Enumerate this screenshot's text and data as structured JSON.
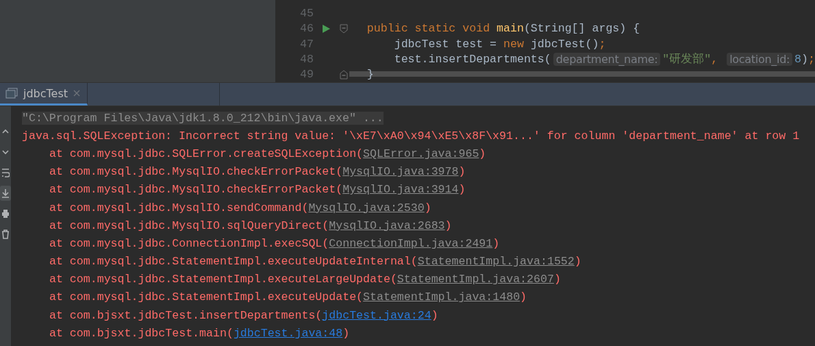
{
  "editor": {
    "lines": [
      {
        "number": "45",
        "run": false,
        "fold_start": false,
        "fold_end": false
      },
      {
        "number": "46",
        "run": true,
        "fold_start": true,
        "fold_end": false,
        "tokens": [
          {
            "kind": "keyword",
            "text": "public static void "
          },
          {
            "kind": "method",
            "text": "main"
          },
          {
            "kind": "plain",
            "text": "(String[] args) {"
          }
        ]
      },
      {
        "number": "47",
        "run": false,
        "fold_start": false,
        "fold_end": false,
        "tokens": [
          {
            "kind": "plain",
            "text": "    jdbcTest test = "
          },
          {
            "kind": "keyword",
            "text": "new "
          },
          {
            "kind": "plain",
            "text": "jdbcTest()"
          },
          {
            "kind": "keyword",
            "text": ";"
          }
        ]
      },
      {
        "number": "48",
        "run": false,
        "fold_start": false,
        "fold_end": false,
        "tokens": [
          {
            "kind": "plain",
            "text": "    test.insertDepartments("
          },
          {
            "kind": "hint",
            "text": "department_name:"
          },
          {
            "kind": "string",
            "text": "\"研发部\""
          },
          {
            "kind": "keyword",
            "text": ", "
          },
          {
            "kind": "hint",
            "text": "location_id:"
          },
          {
            "kind": "number",
            "text": "8"
          },
          {
            "kind": "plain",
            "text": ")"
          },
          {
            "kind": "keyword",
            "text": ";"
          }
        ]
      },
      {
        "number": "49",
        "run": false,
        "fold_start": false,
        "fold_end": true,
        "tokens": [
          {
            "kind": "plain",
            "text": "}"
          }
        ]
      }
    ]
  },
  "run_tabs": [
    {
      "label": "jdbcTest",
      "selected": true
    }
  ],
  "console": {
    "command": "\"C:\\Program Files\\Java\\jdk1.8.0_212\\bin\\java.exe\" ...",
    "error": "java.sql.SQLException: Incorrect string value: '\\xE7\\xA0\\x94\\xE5\\x8F\\x91...' for column 'department_name' at row 1",
    "frames": [
      {
        "text": "at com.mysql.jdbc.SQLError.createSQLException(",
        "link": "SQLError.java:965",
        "close": ")",
        "kind": "library"
      },
      {
        "text": "at com.mysql.jdbc.MysqlIO.checkErrorPacket(",
        "link": "MysqlIO.java:3978",
        "close": ")",
        "kind": "library"
      },
      {
        "text": "at com.mysql.jdbc.MysqlIO.checkErrorPacket(",
        "link": "MysqlIO.java:3914",
        "close": ")",
        "kind": "library"
      },
      {
        "text": "at com.mysql.jdbc.MysqlIO.sendCommand(",
        "link": "MysqlIO.java:2530",
        "close": ")",
        "kind": "library"
      },
      {
        "text": "at com.mysql.jdbc.MysqlIO.sqlQueryDirect(",
        "link": "MysqlIO.java:2683",
        "close": ")",
        "kind": "library"
      },
      {
        "text": "at com.mysql.jdbc.ConnectionImpl.execSQL(",
        "link": "ConnectionImpl.java:2491",
        "close": ")",
        "kind": "library"
      },
      {
        "text": "at com.mysql.jdbc.StatementImpl.executeUpdateInternal(",
        "link": "StatementImpl.java:1552",
        "close": ")",
        "kind": "library"
      },
      {
        "text": "at com.mysql.jdbc.StatementImpl.executeLargeUpdate(",
        "link": "StatementImpl.java:2607",
        "close": ")",
        "kind": "library"
      },
      {
        "text": "at com.mysql.jdbc.StatementImpl.executeUpdate(",
        "link": "StatementImpl.java:1480",
        "close": ")",
        "kind": "library"
      },
      {
        "text": "at com.bjsxt.jdbcTest.insertDepartments(",
        "link": "jdbcTest.java:24",
        "close": ")",
        "kind": "project"
      },
      {
        "text": "at com.bjsxt.jdbcTest.main(",
        "link": "jdbcTest.java:48",
        "close": ")",
        "kind": "project"
      }
    ]
  },
  "console_tools": [
    {
      "kind": "up",
      "selected": false
    },
    {
      "kind": "down",
      "selected": false
    },
    {
      "kind": "wrap",
      "selected": false
    },
    {
      "kind": "scroll-end",
      "selected": true
    },
    {
      "kind": "print",
      "selected": false
    },
    {
      "kind": "trash",
      "selected": false
    }
  ]
}
